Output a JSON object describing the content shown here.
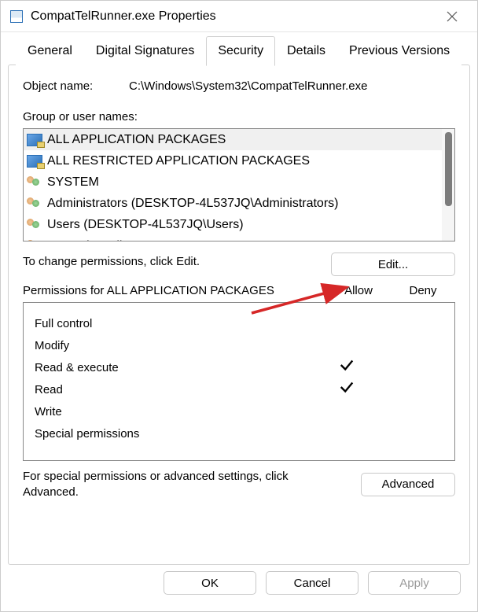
{
  "window": {
    "title": "CompatTelRunner.exe Properties"
  },
  "tabs": [
    "General",
    "Digital Signatures",
    "Security",
    "Details",
    "Previous Versions"
  ],
  "active_tab": "Security",
  "object_name_label": "Object name:",
  "object_name_value": "C:\\Windows\\System32\\CompatTelRunner.exe",
  "group_label": "Group or user names:",
  "principals": [
    {
      "name": "ALL APPLICATION PACKAGES",
      "icon": "pkg",
      "selected": true
    },
    {
      "name": "ALL RESTRICTED APPLICATION PACKAGES",
      "icon": "pkg",
      "selected": false
    },
    {
      "name": "SYSTEM",
      "icon": "users",
      "selected": false
    },
    {
      "name": "Administrators (DESKTOP-4L537JQ\\Administrators)",
      "icon": "users",
      "selected": false
    },
    {
      "name": "Users (DESKTOP-4L537JQ\\Users)",
      "icon": "users",
      "selected": false
    },
    {
      "name": "TrustedInstaller",
      "icon": "users",
      "selected": false
    }
  ],
  "edit_hint": "To change permissions, click Edit.",
  "edit_button": "Edit...",
  "perm_title_prefix": "Permissions for ",
  "perm_title_subject": "ALL APPLICATION PACKAGES",
  "columns": {
    "allow": "Allow",
    "deny": "Deny"
  },
  "permissions": [
    {
      "label": "Full control",
      "allow": false,
      "deny": false
    },
    {
      "label": "Modify",
      "allow": false,
      "deny": false
    },
    {
      "label": "Read & execute",
      "allow": true,
      "deny": false
    },
    {
      "label": "Read",
      "allow": true,
      "deny": false
    },
    {
      "label": "Write",
      "allow": false,
      "deny": false
    },
    {
      "label": "Special permissions",
      "allow": false,
      "deny": false
    }
  ],
  "advanced_hint": "For special permissions or advanced settings, click Advanced.",
  "advanced_button": "Advanced",
  "footer": {
    "ok": "OK",
    "cancel": "Cancel",
    "apply": "Apply"
  }
}
